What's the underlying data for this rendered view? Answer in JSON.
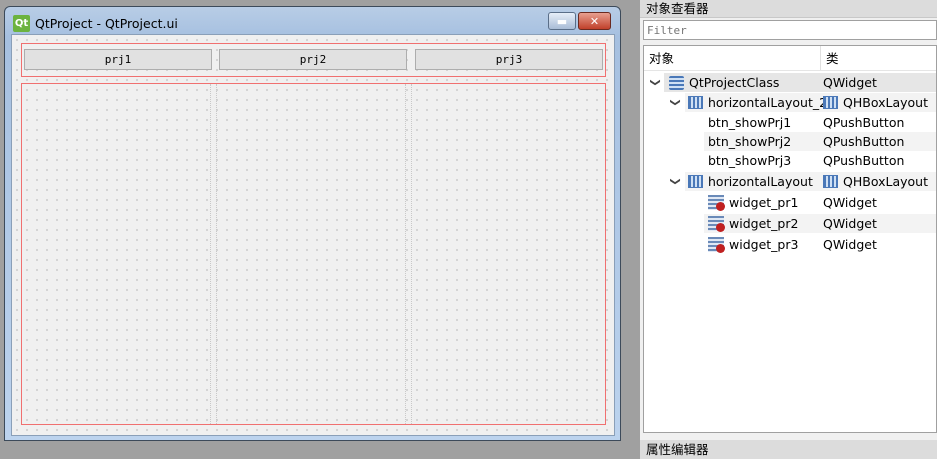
{
  "window": {
    "title": "QtProject - QtProject.ui",
    "icon_text": "Qt",
    "minimize": "▬",
    "close": "✕"
  },
  "buttons": [
    "prj1",
    "prj2",
    "prj3"
  ],
  "object_inspector": {
    "title": "对象查看器",
    "filter_placeholder": "Filter",
    "col_object": "对象",
    "col_class": "类",
    "rows": [
      {
        "name": "QtProjectClass",
        "cls": "QWidget"
      },
      {
        "name": "horizontalLayout_2",
        "cls": "QHBoxLayout"
      },
      {
        "name": "btn_showPrj1",
        "cls": "QPushButton"
      },
      {
        "name": "btn_showPrj2",
        "cls": "QPushButton"
      },
      {
        "name": "btn_showPrj3",
        "cls": "QPushButton"
      },
      {
        "name": "horizontalLayout",
        "cls": "QHBoxLayout"
      },
      {
        "name": "widget_pr1",
        "cls": "QWidget"
      },
      {
        "name": "widget_pr2",
        "cls": "QWidget"
      },
      {
        "name": "widget_pr3",
        "cls": "QWidget"
      }
    ]
  },
  "property_editor": {
    "title": "属性编辑器"
  }
}
